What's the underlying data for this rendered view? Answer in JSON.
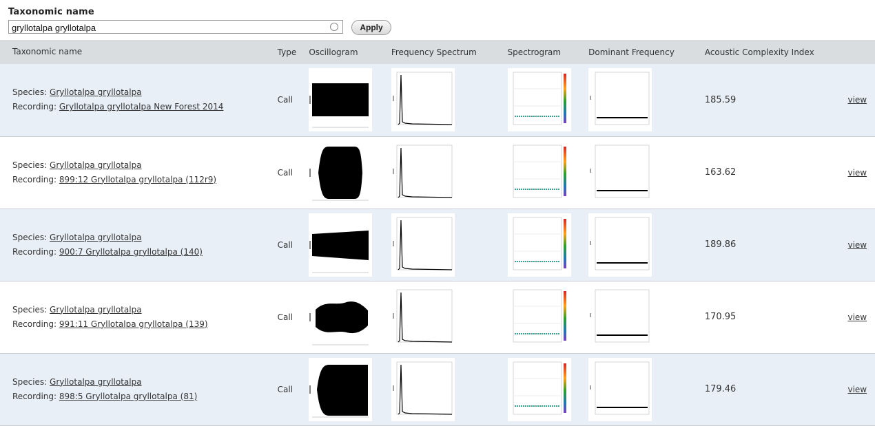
{
  "filter": {
    "label": "Taxonomic name",
    "value": "gryllotalpa gryllotalpa",
    "apply_label": "Apply"
  },
  "table": {
    "headers": [
      "Taxonomic name",
      "Type",
      "Oscillogram",
      "Frequency Spectrum",
      "Spectrogram",
      "Dominant Frequency",
      "Acoustic Complexity Index"
    ],
    "rows": [
      {
        "species_prefix": "Species: ",
        "species": "Gryllotalpa gryllotalpa",
        "recording_prefix": "Recording: ",
        "recording": "Gryllotalpa gryllotalpa New Forest 2014",
        "type": "Call",
        "aci": "185.59",
        "view": "view"
      },
      {
        "species_prefix": "Species: ",
        "species": "Gryllotalpa gryllotalpa",
        "recording_prefix": "Recording: ",
        "recording": "899:12 Gryllotalpa gryllotalpa (112r9)",
        "type": "Call",
        "aci": "163.62",
        "view": "view"
      },
      {
        "species_prefix": "Species: ",
        "species": "Gryllotalpa gryllotalpa",
        "recording_prefix": "Recording: ",
        "recording": "900:7 Gryllotalpa gryllotalpa (140)",
        "type": "Call",
        "aci": "189.86",
        "view": "view"
      },
      {
        "species_prefix": "Species: ",
        "species": "Gryllotalpa gryllotalpa",
        "recording_prefix": "Recording: ",
        "recording": "991:11 Gryllotalpa gryllotalpa (139)",
        "type": "Call",
        "aci": "170.95",
        "view": "view"
      },
      {
        "species_prefix": "Species: ",
        "species": "Gryllotalpa gryllotalpa",
        "recording_prefix": "Recording: ",
        "recording": "898:5 Gryllotalpa gryllotalpa (81)",
        "type": "Call",
        "aci": "179.46",
        "view": "view"
      }
    ]
  },
  "colors": {
    "header_bg": "#d9dde0",
    "row_shade": "#e8eff7"
  }
}
